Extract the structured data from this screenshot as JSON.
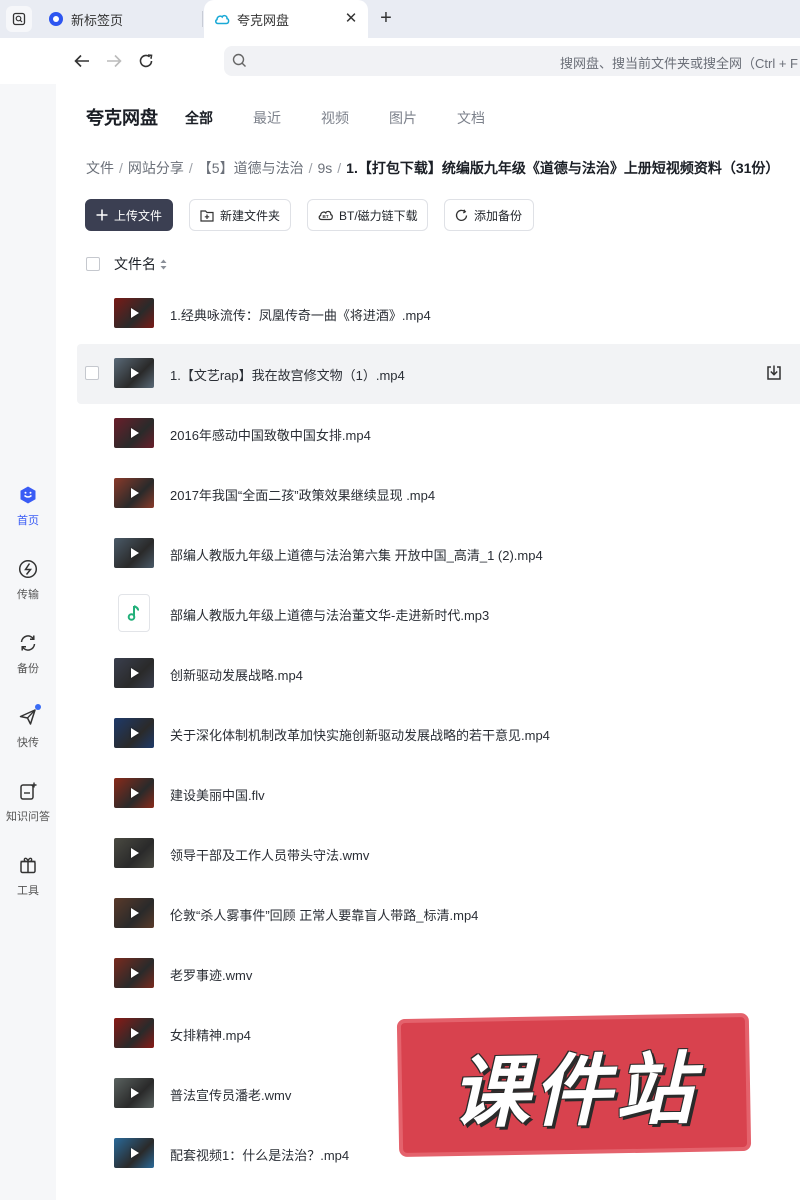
{
  "browser": {
    "tabs": [
      {
        "label": "新标签页",
        "active": false
      },
      {
        "label": "夸克网盘",
        "active": true
      }
    ],
    "address_placeholder": "搜网盘、搜当前文件夹或搜全网（Ctrl + F"
  },
  "sidebar": {
    "items": [
      {
        "label": "首页",
        "icon": "home-icon",
        "active": true
      },
      {
        "label": "传输",
        "icon": "transfer-icon",
        "active": false
      },
      {
        "label": "备份",
        "icon": "backup-icon",
        "active": false
      },
      {
        "label": "快传",
        "icon": "quick-send-icon",
        "active": false,
        "badge_dot": true
      },
      {
        "label": "知识问答",
        "icon": "knowledge-qa-icon",
        "active": false
      },
      {
        "label": "工具",
        "icon": "toolbox-icon",
        "active": false
      }
    ]
  },
  "header": {
    "brand": "夸克网盘",
    "tabs": [
      {
        "label": "全部",
        "active": true
      },
      {
        "label": "最近",
        "active": false
      },
      {
        "label": "视频",
        "active": false
      },
      {
        "label": "图片",
        "active": false
      },
      {
        "label": "文档",
        "active": false
      }
    ]
  },
  "breadcrumb": {
    "items": [
      "文件",
      "网站分享",
      "【5】道德与法治",
      "9s"
    ],
    "current": "1.【打包下载】统编版九年级《道德与法治》上册短视频资料（31份）"
  },
  "toolbar": {
    "upload": "上传文件",
    "new_folder": "新建文件夹",
    "bt_download": "BT/磁力链下载",
    "add_backup": "添加备份"
  },
  "list": {
    "column_name": "文件名",
    "files": [
      {
        "name": "1.经典咏流传：凤凰传奇一曲《将进酒》.mp4",
        "type": "video",
        "thumb_color": "#7a1a16"
      },
      {
        "name": "1.【文艺rap】我在故宫修文物（1）.mp4",
        "type": "video",
        "thumb_color": "#5a6a78"
      },
      {
        "name": "2016年感动中国致敬中国女排.mp4",
        "type": "video",
        "thumb_color": "#6a1e2a"
      },
      {
        "name": "2017年我国“全面二孩”政策效果继续显现 .mp4",
        "type": "video",
        "thumb_color": "#8a3a2a"
      },
      {
        "name": "部编人教版九年级上道德与法治第六集 开放中国_高清_1 (2).mp4",
        "type": "video",
        "thumb_color": "#4a5a68"
      },
      {
        "name": "部编人教版九年级上道德与法治董文华-走进新时代.mp3",
        "type": "audio",
        "thumb_color": "#22b07a"
      },
      {
        "name": "创新驱动发展战略.mp4",
        "type": "video",
        "thumb_color": "#3a3f4e"
      },
      {
        "name": "关于深化体制机制改革加快实施创新驱动发展战略的若干意见.mp4",
        "type": "video",
        "thumb_color": "#1e3a6a"
      },
      {
        "name": "建设美丽中国.flv",
        "type": "video",
        "thumb_color": "#8a2a1a"
      },
      {
        "name": "领导干部及工作人员带头守法.wmv",
        "type": "video",
        "thumb_color": "#4a4a42"
      },
      {
        "name": "伦敦“杀人雾事件”回顾 正常人要靠盲人带路_标清.mp4",
        "type": "video",
        "thumb_color": "#5a3a2a"
      },
      {
        "name": "老罗事迹.wmv",
        "type": "video",
        "thumb_color": "#7a2a1e"
      },
      {
        "name": "女排精神.mp4",
        "type": "video",
        "thumb_color": "#8a1a16"
      },
      {
        "name": "普法宣传员潘老.wmv",
        "type": "video",
        "thumb_color": "#5a6260"
      },
      {
        "name": "配套视频1：什么是法治？.mp4",
        "type": "video",
        "thumb_color": "#2a6a9a"
      }
    ],
    "hover_row": 1
  },
  "watermark": {
    "text": "课件站"
  }
}
